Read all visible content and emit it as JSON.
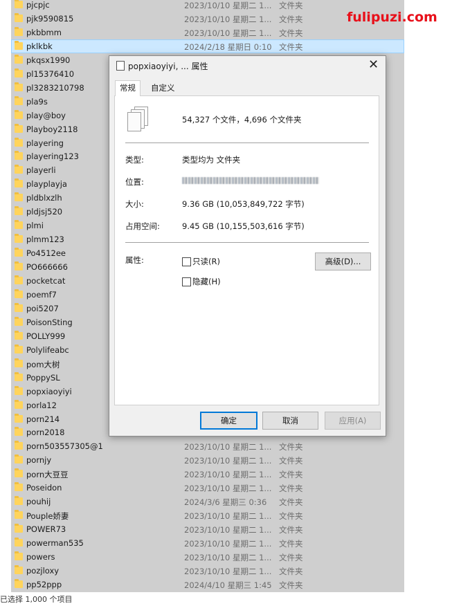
{
  "files": [
    {
      "name": "pjcpjc",
      "date": "2023/10/10 星期二 1...",
      "type": "文件夹",
      "selected": false
    },
    {
      "name": "pjk9590815",
      "date": "2023/10/10 星期二 1...",
      "type": "文件夹",
      "selected": false
    },
    {
      "name": "pkbbmm",
      "date": "2023/10/10 星期二 1...",
      "type": "文件夹",
      "selected": false
    },
    {
      "name": "pklkbk",
      "date": "2024/2/18 星期日 0:10",
      "type": "文件夹",
      "selected": true
    },
    {
      "name": "pkqsx1990",
      "date": "",
      "type": "",
      "selected": false
    },
    {
      "name": "pl15376410",
      "date": "",
      "type": "",
      "selected": false
    },
    {
      "name": "pl3283210798",
      "date": "",
      "type": "",
      "selected": false
    },
    {
      "name": "pla9s",
      "date": "",
      "type": "",
      "selected": false
    },
    {
      "name": "play@boy",
      "date": "",
      "type": "",
      "selected": false
    },
    {
      "name": "Playboy2118",
      "date": "",
      "type": "",
      "selected": false
    },
    {
      "name": "playering",
      "date": "",
      "type": "",
      "selected": false
    },
    {
      "name": "playering123",
      "date": "",
      "type": "",
      "selected": false
    },
    {
      "name": "playerli",
      "date": "",
      "type": "",
      "selected": false
    },
    {
      "name": "playplayja",
      "date": "",
      "type": "",
      "selected": false
    },
    {
      "name": "pldblxzlh",
      "date": "",
      "type": "",
      "selected": false
    },
    {
      "name": "pldjsj520",
      "date": "",
      "type": "",
      "selected": false
    },
    {
      "name": "plmi",
      "date": "",
      "type": "",
      "selected": false
    },
    {
      "name": "plmm123",
      "date": "",
      "type": "",
      "selected": false
    },
    {
      "name": "Po4512ee",
      "date": "",
      "type": "",
      "selected": false
    },
    {
      "name": "PO666666",
      "date": "",
      "type": "",
      "selected": false
    },
    {
      "name": "pocketcat",
      "date": "",
      "type": "",
      "selected": false
    },
    {
      "name": "poemf7",
      "date": "",
      "type": "",
      "selected": false
    },
    {
      "name": "poi5207",
      "date": "",
      "type": "",
      "selected": false
    },
    {
      "name": "PoisonSting",
      "date": "",
      "type": "",
      "selected": false
    },
    {
      "name": "POLLY999",
      "date": "",
      "type": "",
      "selected": false
    },
    {
      "name": "Polylifeabc",
      "date": "",
      "type": "",
      "selected": false
    },
    {
      "name": "pom大树",
      "date": "",
      "type": "",
      "selected": false
    },
    {
      "name": "PoppySL",
      "date": "",
      "type": "",
      "selected": false
    },
    {
      "name": "popxiaoyiyi",
      "date": "",
      "type": "",
      "selected": false
    },
    {
      "name": "porla12",
      "date": "",
      "type": "",
      "selected": false
    },
    {
      "name": "porn214",
      "date": "",
      "type": "",
      "selected": false
    },
    {
      "name": "porn2018",
      "date": "",
      "type": "",
      "selected": false
    },
    {
      "name": "porn503557305@1",
      "date": "2023/10/10 星期二 1...",
      "type": "文件夹",
      "selected": false
    },
    {
      "name": "pornjy",
      "date": "2023/10/10 星期二 1...",
      "type": "文件夹",
      "selected": false
    },
    {
      "name": "porn大豆豆",
      "date": "2023/10/10 星期二 1...",
      "type": "文件夹",
      "selected": false
    },
    {
      "name": "Poseidon",
      "date": "2023/10/10 星期二 1...",
      "type": "文件夹",
      "selected": false
    },
    {
      "name": "pouhij",
      "date": "2024/3/6 星期三 0:36",
      "type": "文件夹",
      "selected": false
    },
    {
      "name": "Pouple娇妻",
      "date": "2023/10/10 星期二 1...",
      "type": "文件夹",
      "selected": false
    },
    {
      "name": "POWER73",
      "date": "2023/10/10 星期二 1...",
      "type": "文件夹",
      "selected": false
    },
    {
      "name": "powerman535",
      "date": "2023/10/10 星期二 1...",
      "type": "文件夹",
      "selected": false
    },
    {
      "name": "powers",
      "date": "2023/10/10 星期二 1...",
      "type": "文件夹",
      "selected": false
    },
    {
      "name": "pozjloxy",
      "date": "2023/10/10 星期二 1...",
      "type": "文件夹",
      "selected": false
    },
    {
      "name": "pp52ppp",
      "date": "2024/4/10 星期三 1:45",
      "type": "文件夹",
      "selected": false
    }
  ],
  "status_bar": "已选择 1,000 个项目",
  "watermark": "fulipuzi.com",
  "dialog": {
    "title": "popxiaoyiyi, ... 属性",
    "close": "✕",
    "tabs": [
      "常规",
      "自定义"
    ],
    "summary": "54,327 个文件，4,696 个文件夹",
    "type_label": "类型:",
    "type_value": "类型均为 文件夹",
    "location_label": "位置:",
    "size_label": "大小:",
    "size_value": "9.36 GB (10,053,849,722 字节)",
    "disk_label": "占用空间:",
    "disk_value": "9.45 GB (10,155,503,616 字节)",
    "attr_label": "属性:",
    "readonly_label": "只读(R)",
    "hidden_label": "隐藏(H)",
    "advanced_button": "高级(D)...",
    "ok_button": "确定",
    "cancel_button": "取消",
    "apply_button": "应用(A)"
  }
}
